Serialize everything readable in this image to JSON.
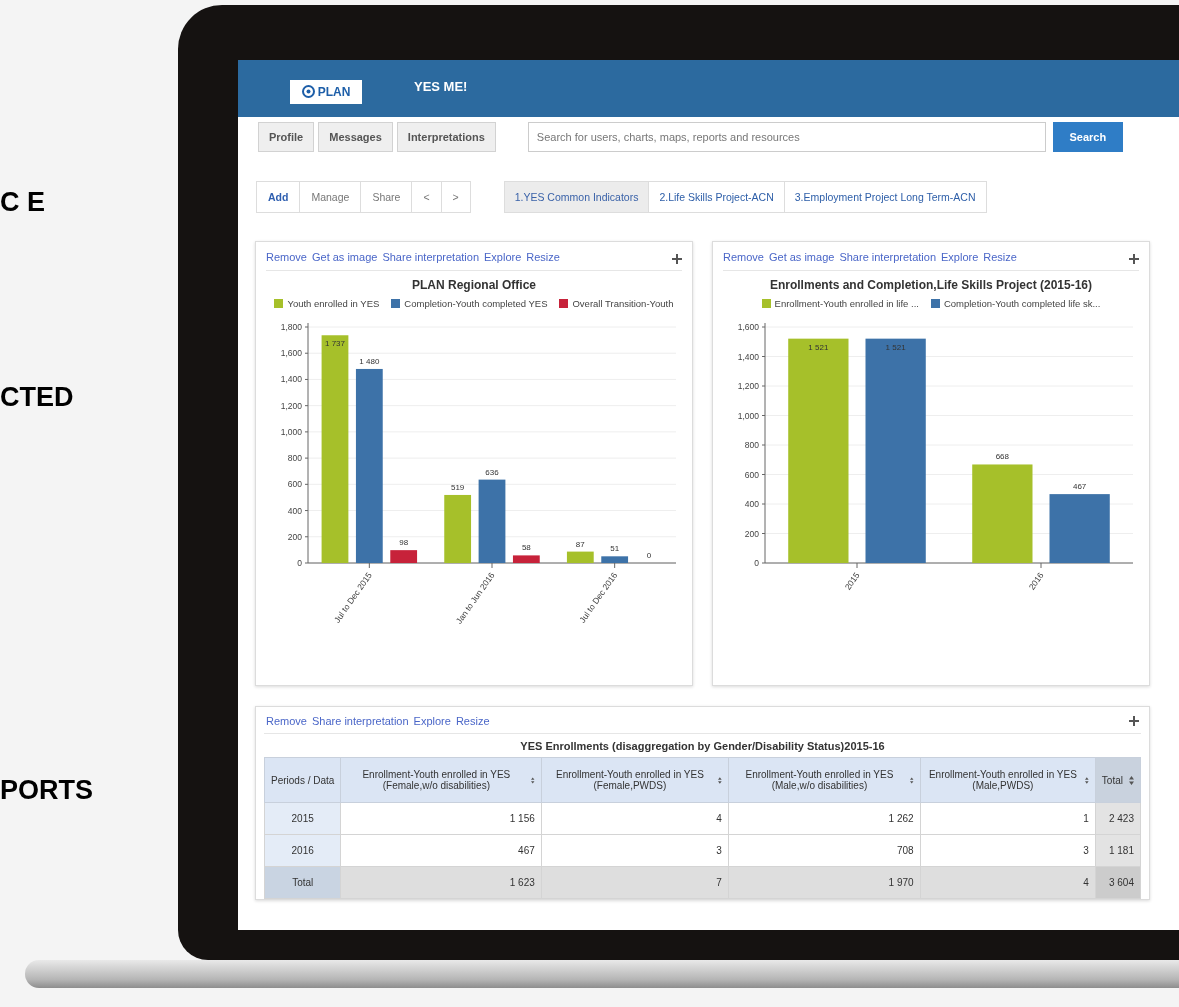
{
  "side_text": [
    "C E",
    "CTED",
    "PORTS"
  ],
  "header": {
    "logo_text": "PLAN",
    "title": "YES ME!"
  },
  "nav_buttons": [
    "Profile",
    "Messages",
    "Interpretations"
  ],
  "search": {
    "placeholder": "Search for users, charts, maps, reports and resources",
    "button": "Search"
  },
  "dashboard_actions": [
    "Add",
    "Manage",
    "Share",
    "<",
    ">"
  ],
  "dashboard_tabs": [
    {
      "label": "1.YES Common Indicators",
      "selected": true
    },
    {
      "label": "2.Life Skills Project-ACN",
      "selected": false
    },
    {
      "label": "3.Employment Project Long Term-ACN",
      "selected": false
    }
  ],
  "panels": [
    {
      "actions": [
        "Remove",
        "Get as image",
        "Share interpretation",
        "Explore",
        "Resize"
      ],
      "chart_data": {
        "type": "bar",
        "title": "PLAN Regional Office",
        "categories": [
          "Jul to Dec 2015",
          "Jan to Jun 2016",
          "Jul to Dec 2016"
        ],
        "series": [
          {
            "name": "Youth enrolled in YES",
            "color": "#a6c02a",
            "values": [
              1737,
              519,
              87
            ]
          },
          {
            "name": "Completion-Youth completed YES",
            "color": "#3d72a8",
            "values": [
              1480,
              636,
              51
            ]
          },
          {
            "name": "Overall Transition-Youth",
            "color": "#c7223a",
            "values": [
              98,
              58,
              0
            ]
          }
        ],
        "ylim": [
          0,
          1800
        ],
        "yticks": [
          0,
          200,
          400,
          600,
          800,
          {
            "value": 1000,
            "label": "1,000"
          },
          {
            "value": 1200,
            "label": "1,200"
          },
          {
            "value": 1400,
            "label": "1,400"
          },
          {
            "value": 1600,
            "label": "1,600"
          },
          {
            "value": 1800,
            "label": "1,800"
          }
        ],
        "grid": true,
        "value_labels": [
          [
            "1 737",
            "519",
            "87"
          ],
          [
            "1 480",
            "636",
            "51"
          ],
          [
            "98",
            "58",
            "0"
          ]
        ]
      }
    },
    {
      "actions": [
        "Remove",
        "Get as image",
        "Share interpretation",
        "Explore",
        "Resize"
      ],
      "chart_data": {
        "type": "bar",
        "title": "Enrollments and Completion,Life Skills Project (2015-16)",
        "categories": [
          "2015",
          "2016"
        ],
        "series": [
          {
            "name": "Enrollment-Youth enrolled in life ...",
            "color": "#a6c02a",
            "values": [
              1521,
              668
            ]
          },
          {
            "name": "Completion-Youth completed life sk...",
            "color": "#3d72a8",
            "values": [
              1521,
              467
            ]
          }
        ],
        "ylim": [
          0,
          1600
        ],
        "yticks": [
          0,
          200,
          400,
          600,
          800,
          {
            "value": 1000,
            "label": "1,000"
          },
          {
            "value": 1200,
            "label": "1,200"
          },
          {
            "value": 1400,
            "label": "1,400"
          },
          {
            "value": 1600,
            "label": "1,600"
          }
        ],
        "grid": true,
        "value_labels": [
          [
            "1 521",
            "668"
          ],
          [
            "1 521",
            "467"
          ]
        ]
      }
    }
  ],
  "table_panel": {
    "actions": [
      "Remove",
      "Share interpretation",
      "Explore",
      "Resize"
    ],
    "title": "YES Enrollments (disaggregation by Gender/Disability Status)2015-16",
    "columns": [
      {
        "label": "Periods / Data",
        "sortable": false
      },
      {
        "label": "Enrollment-Youth enrolled in YES (Female,w/o disabilities)",
        "sortable": true
      },
      {
        "label": "Enrollment-Youth enrolled in YES (Female,PWDS)",
        "sortable": true
      },
      {
        "label": "Enrollment-Youth enrolled in YES (Male,w/o disabilities)",
        "sortable": true
      },
      {
        "label": "Enrollment-Youth enrolled in YES (Male,PWDS)",
        "sortable": true
      },
      {
        "label": "Total",
        "sortable": true
      }
    ],
    "rows": [
      {
        "kind": "data",
        "cells": [
          "2015",
          "1 156",
          "4",
          "1 262",
          "1",
          "2 423"
        ]
      },
      {
        "kind": "data",
        "cells": [
          "2016",
          "467",
          "3",
          "708",
          "3",
          "1 181"
        ]
      },
      {
        "kind": "total",
        "cells": [
          "Total",
          "1 623",
          "7",
          "1 970",
          "4",
          "3 604"
        ]
      }
    ]
  }
}
